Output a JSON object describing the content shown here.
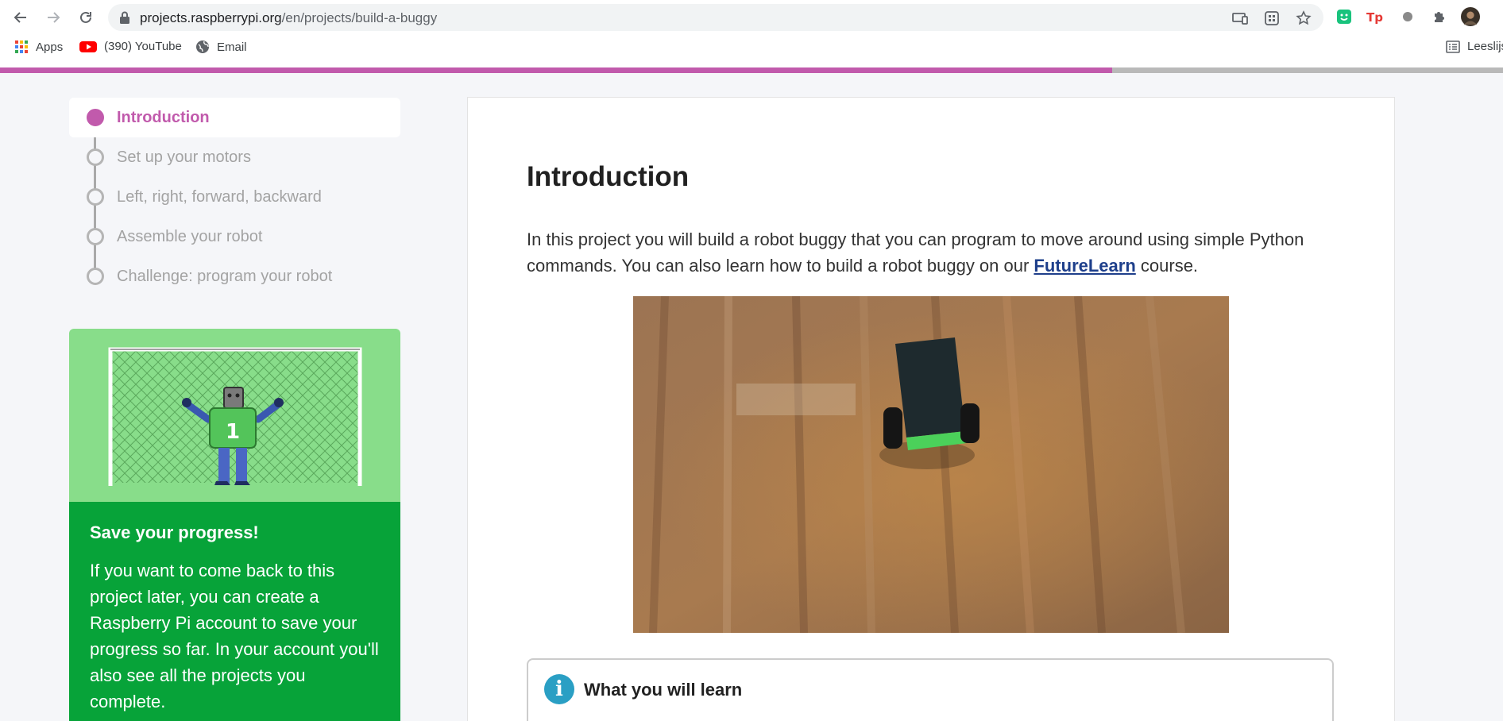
{
  "browser": {
    "url_host": "projects.raspberrypi.org",
    "url_path": "/en/projects/build-a-buggy",
    "bookmarks": [
      {
        "label": "Apps",
        "icon": "apps-grid-icon"
      },
      {
        "label": "(390) YouTube",
        "icon": "youtube-icon"
      },
      {
        "label": "Email",
        "icon": "globe-icon"
      }
    ],
    "reading_list_label": "Leeslijst",
    "extensions": [
      "grammarly-icon",
      "tp-icon",
      "extension-icon",
      "puzzle-icon",
      "profile-avatar"
    ]
  },
  "progress": {
    "fraction": 0.74,
    "fill_color": "#c15aac",
    "track_color": "#b9b9b9"
  },
  "sidebar": {
    "steps": [
      {
        "label": "Introduction",
        "active": true
      },
      {
        "label": "Set up your motors",
        "active": false
      },
      {
        "label": "Left, right, forward, backward",
        "active": false
      },
      {
        "label": "Assemble your robot",
        "active": false
      },
      {
        "label": "Challenge: program your robot",
        "active": false
      }
    ],
    "save_card": {
      "goalie_number": "1",
      "title": "Save your progress!",
      "text": "If you want to come back to this project later, you can create a Raspberry Pi account to save your progress so far. In your account you'll also see all the projects you complete."
    }
  },
  "main": {
    "title": "Introduction",
    "intro_before": "In this project you will build a robot buggy that you can program to move around using simple Python commands. You can also learn how to build a robot buggy on our ",
    "intro_link": "FutureLearn",
    "intro_after": " course.",
    "learn_box_title": "What you will learn"
  },
  "colors": {
    "accent": "#c15aac",
    "save_green": "#07a339",
    "illus_green": "#88dd8a",
    "link": "#1e3f8b",
    "info_blue": "#2a9fc4"
  }
}
